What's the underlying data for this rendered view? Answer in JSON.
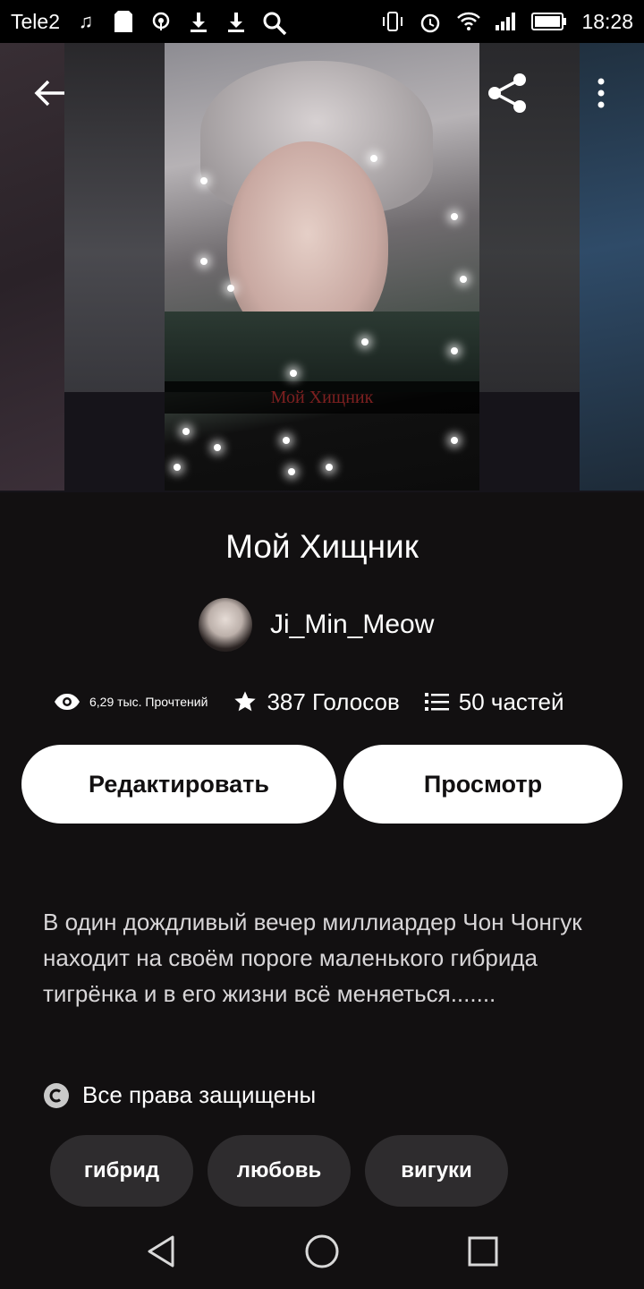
{
  "status_bar": {
    "carrier": "Tele2",
    "time": "18:28",
    "left_icons": [
      "music-note-icon",
      "sd-card-icon",
      "hotspot-icon",
      "download-icon",
      "download-icon",
      "search-icon"
    ],
    "right_icons": [
      "vibrate-icon",
      "alarm-icon",
      "wifi-icon",
      "signal-icon",
      "battery-icon"
    ]
  },
  "cover": {
    "title_overlay": "Мой Хищник"
  },
  "story": {
    "title": "Мой Хищник",
    "author": "Ji_Min_Meow",
    "reads": "6,29 тыс. Прочтений",
    "votes": "387 Голосов",
    "parts": "50 частей"
  },
  "actions": {
    "edit_label": "Редактировать",
    "view_label": "Просмотр"
  },
  "description": "В один  дождливый вечер миллиардер Чон Чонгук находит на своём пороге маленького гибрида тигрёнка и в его жизни всё меняеться.......",
  "copyright": "Все права защищены",
  "tags": [
    "гибрид",
    "любовь",
    "вигуки"
  ],
  "colors": {
    "background": "#121011",
    "button_bg": "#ffffff",
    "tag_bg": "#2e2c2e",
    "text": "#ffffff"
  }
}
